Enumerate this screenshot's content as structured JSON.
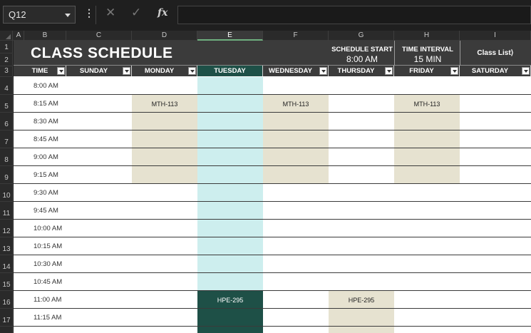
{
  "formula_bar": {
    "name_box": "Q12",
    "dots": "⋮",
    "cancel_glyph": "✕",
    "enter_glyph": "✓",
    "fx": "fx",
    "content": ""
  },
  "columns": [
    "A",
    "B",
    "C",
    "D",
    "E",
    "F",
    "G",
    "H",
    "I"
  ],
  "active_column": "E",
  "rows": [
    "1",
    "2",
    "3",
    "4",
    "5",
    "6",
    "7",
    "8",
    "9",
    "10",
    "11",
    "12",
    "13",
    "14",
    "15",
    "16",
    "17"
  ],
  "schedule": {
    "title": "CLASS SCHEDULE",
    "schedule_start_label": "SCHEDULE START",
    "schedule_start_value": "8:00 AM",
    "time_interval_label": "TIME INTERVAL",
    "time_interval_value": "15 MIN",
    "class_list_link": "Class List⟩",
    "headers": [
      "TIME",
      "SUNDAY",
      "MONDAY",
      "TUESDAY",
      "WEDNESDAY",
      "THURSDAY",
      "FRIDAY",
      "SATURDAY"
    ],
    "times": [
      "8:00 AM",
      "8:15 AM",
      "8:30 AM",
      "8:45 AM",
      "9:00 AM",
      "9:15 AM",
      "9:30 AM",
      "9:45 AM",
      "10:00 AM",
      "10:15 AM",
      "10:30 AM",
      "10:45 AM",
      "11:00 AM",
      "11:15 AM"
    ],
    "events": {
      "monday": "MTH-113",
      "wednesday": "MTH-113",
      "friday": "MTH-113",
      "tuesday": "HPE-295",
      "thursday": "HPE-295"
    }
  },
  "colors": {
    "header_bg": "#3b3b3b",
    "accent_teal": "#1e5047",
    "light_teal": "#cdeeee",
    "beige": "#e6e2d0"
  }
}
